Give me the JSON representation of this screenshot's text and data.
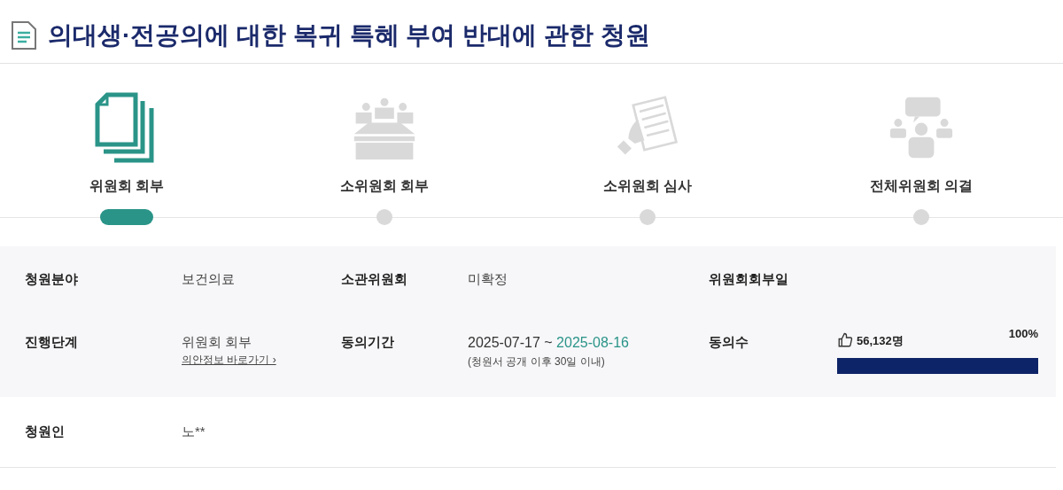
{
  "title": "의대생·전공의에 대한 복귀 특혜 부여 반대에 관한 청원",
  "steps": [
    {
      "kind": "documents",
      "label": "위원회 회부",
      "selected": true
    },
    {
      "kind": "meeting",
      "label": "소위원회 회부",
      "selected": false
    },
    {
      "kind": "review",
      "label": "소위원회 심사",
      "selected": false
    },
    {
      "kind": "discussion",
      "label": "전체위원회 의결",
      "selected": false
    }
  ],
  "details": {
    "field": {
      "label": "청원분야",
      "value": "보건의료"
    },
    "committee": {
      "label": "소관위원회",
      "value": "미확정"
    },
    "committee_date": {
      "label": "위원회회부일"
    },
    "stage": {
      "label": "진행단계",
      "value": "위원회 회부",
      "link": "의안정보 바로가기 ›"
    },
    "period": {
      "label": "동의기간",
      "start": "2025-07-17",
      "separator": "~",
      "end": "2025-08-16",
      "note": "(청원서 공개 이후 30일 이내)"
    },
    "agreement": {
      "label": "동의수",
      "count": "56,132명",
      "percent": "100%",
      "level": 1
    },
    "petitioner": {
      "label": "청원인",
      "value": "노**"
    }
  }
}
